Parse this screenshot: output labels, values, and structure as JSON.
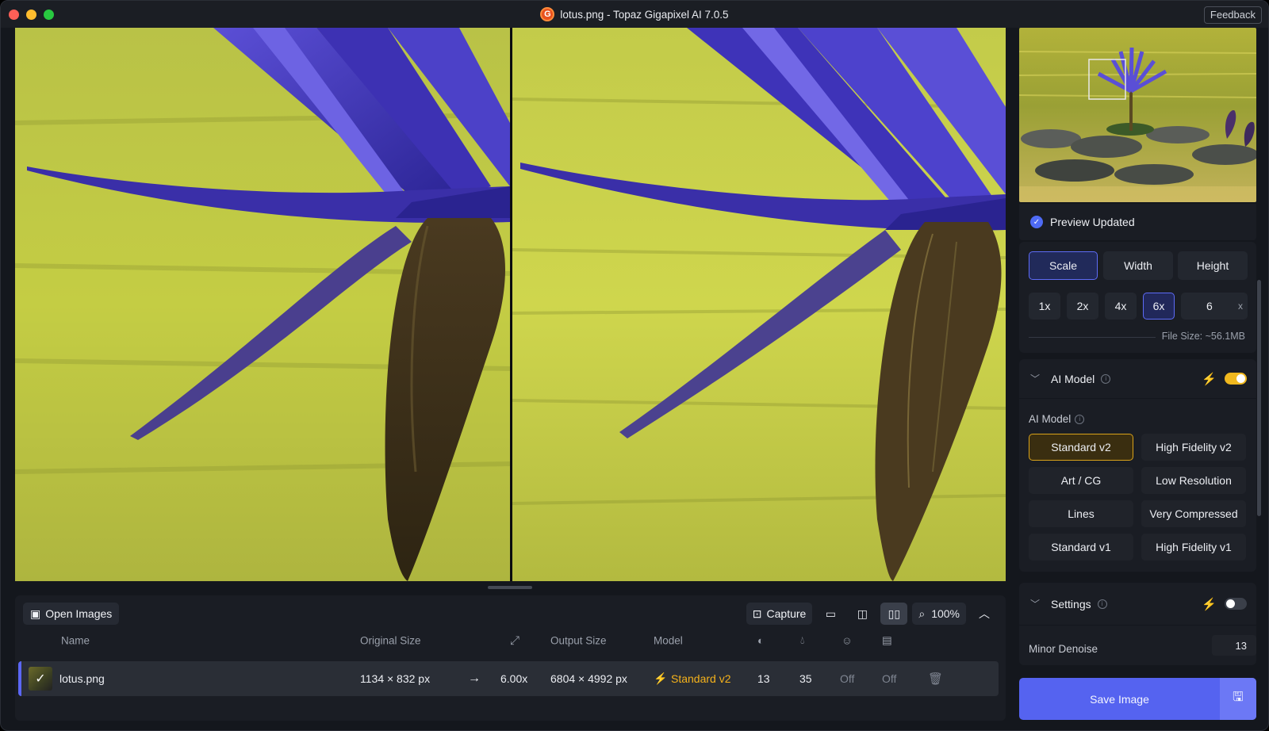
{
  "window": {
    "title": "lotus.png - Topaz Gigapixel AI 7.0.5",
    "logo_letter": "G",
    "feedback_label": "Feedback"
  },
  "toolbar": {
    "open_images_label": "Open Images",
    "capture_label": "Capture",
    "zoom_level": "100%"
  },
  "table": {
    "headers": {
      "name": "Name",
      "original_size": "Original Size",
      "output_size": "Output Size",
      "model": "Model"
    },
    "rows": [
      {
        "name": "lotus.png",
        "original_size": "1134 × 832 px",
        "scale": "6.00x",
        "output_size": "6804 × 4992 px",
        "model": "Standard v2",
        "denoise": "13",
        "sharpen": "35",
        "face_recovery": "Off",
        "compression": "Off"
      }
    ]
  },
  "sidebar": {
    "preview_status": "Preview Updated",
    "resize_modes": [
      "Scale",
      "Width",
      "Height"
    ],
    "selected_resize_mode": "Scale",
    "scale_presets": [
      "1x",
      "2x",
      "4x",
      "6x"
    ],
    "selected_scale": "6x",
    "custom_scale_value": "6",
    "custom_scale_unit": "x",
    "file_size": "File Size: ~56.1MB",
    "ai_model_section": {
      "title": "AI Model",
      "enabled": true,
      "label": "AI Model",
      "models": [
        "Standard v2",
        "High Fidelity v2",
        "Art / CG",
        "Low Resolution",
        "Lines",
        "Very Compressed",
        "Standard v1",
        "High Fidelity v1"
      ],
      "selected_model": "Standard v2"
    },
    "settings_section": {
      "title": "Settings",
      "enabled": false,
      "minor_denoise_label": "Minor Denoise",
      "minor_denoise_value": "13"
    },
    "save_label": "Save Image"
  },
  "colors": {
    "accent": "#5563f0",
    "model_highlight": "#f5b21b",
    "toggle_on": "#f0b81e"
  }
}
